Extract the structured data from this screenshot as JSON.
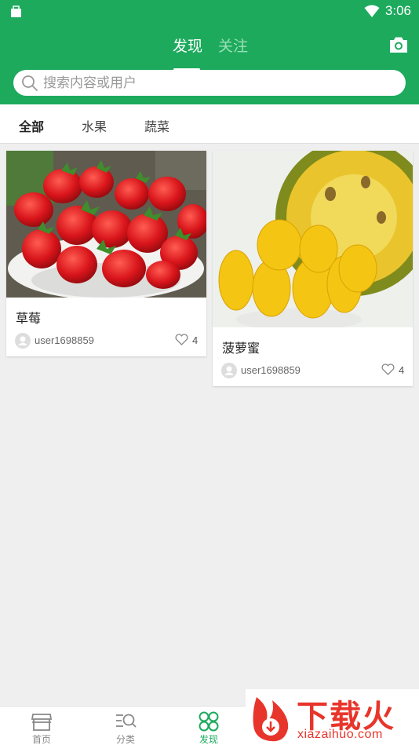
{
  "status_bar": {
    "time": "3:06"
  },
  "header": {
    "tabs": [
      {
        "label": "发现",
        "active": true
      },
      {
        "label": "关注",
        "active": false
      }
    ],
    "search_placeholder": "搜索内容或用户"
  },
  "categories": [
    {
      "label": "全部",
      "active": true
    },
    {
      "label": "水果",
      "active": false
    },
    {
      "label": "蔬菜",
      "active": false
    }
  ],
  "posts": [
    {
      "title": "草莓",
      "user": "user1698859",
      "likes": "4",
      "image": "strawberries"
    },
    {
      "title": "菠萝蜜",
      "user": "user1698859",
      "likes": "4",
      "image": "jackfruit"
    }
  ],
  "bottom_nav": [
    {
      "label": "首页",
      "icon": "store-icon",
      "active": false
    },
    {
      "label": "分类",
      "icon": "category-search-icon",
      "active": false
    },
    {
      "label": "发现",
      "icon": "discover-icon",
      "active": true
    }
  ],
  "watermark": {
    "brand": "下载火",
    "domain": "xiazaihuo.com"
  },
  "colors": {
    "primary": "#1daa5d",
    "background": "#efefef",
    "watermark": "#e8352b"
  }
}
